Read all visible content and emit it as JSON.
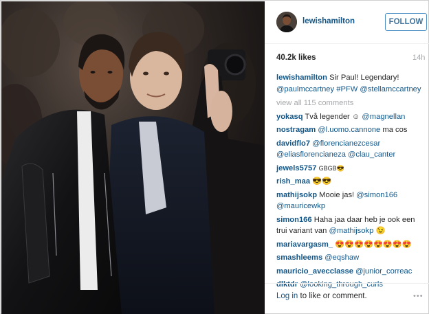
{
  "post": {
    "username": "lewishamilton",
    "follow_label": "FOLLOW",
    "likes": "40.2k likes",
    "time": "14h",
    "caption": {
      "user": "lewishamilton",
      "text": "Sir Paul! Legendary!",
      "mentions": [
        "@paulmccartney",
        "#PFW",
        "@stellamccartney"
      ]
    },
    "view_all": "view all 115 comments",
    "comments": [
      {
        "user": "yokasq",
        "text": "Två legender ☺",
        "mentions": "@magnellan"
      },
      {
        "user": "nostragam",
        "text": "",
        "mentions": "@l.uomo.cannone",
        "text_after": "ma cos"
      },
      {
        "user": "davidflo7",
        "text": "",
        "mentions": "@florencianezcesar @eliasflorencianeza @clau_canter"
      },
      {
        "user": "jewels5757",
        "text": "GBGB😎",
        "mentions": ""
      },
      {
        "user": "rish_maa",
        "text": "😎😎",
        "mentions": ""
      },
      {
        "user": "mathijsokp",
        "text": "Mooie jas!",
        "mentions": "@simon166 @mauricewkp"
      },
      {
        "user": "simon166",
        "text": "Haha jaa daar heb je ook een trui variant van",
        "mentions": "@mathijsokp",
        "text_after": "😉"
      },
      {
        "user": "mariavargasm_",
        "text": "😍😍😍😍😍😍😍😍",
        "mentions": ""
      },
      {
        "user": "smashleems",
        "text": "",
        "mentions": "@eqshaw"
      },
      {
        "user": "mauricio_avecclasse",
        "text": "",
        "mentions": "@junior_correac"
      },
      {
        "user": "dlktdr",
        "text": "",
        "mentions": "@looking_through_curls"
      }
    ],
    "login_link": "Log in",
    "login_rest": "to like or comment.",
    "more_icon": "•••"
  },
  "colors": {
    "link": "#125688",
    "follow_border": "#4f90c4",
    "muted": "#a5a7aa"
  }
}
